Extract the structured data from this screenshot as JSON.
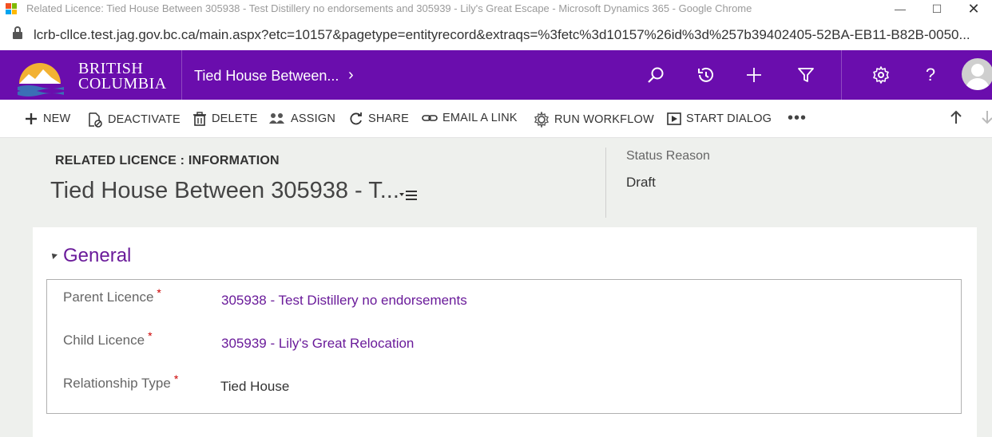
{
  "window": {
    "title": "Related Licence: Tied House Between 305938 - Test Distillery no endorsements and 305939 - Lily's Great Escape - Microsoft Dynamics 365 - Google Chrome"
  },
  "browser": {
    "url": "lcrb-cllce.test.jag.gov.bc.ca/main.aspx?etc=10157&pagetype=entityrecord&extraqs=%3fetc%3d10157%26id%3d%257b39402405-52BA-EB11-B82B-0050..."
  },
  "nav": {
    "logo_line1": "BRITISH",
    "logo_line2": "COLUMBIA",
    "breadcrumb": "Tied House Between...",
    "chevron": "›"
  },
  "commands": {
    "new": "NEW",
    "deactivate": "DEACTIVATE",
    "delete": "DELETE",
    "assign": "ASSIGN",
    "share": "SHARE",
    "email_link": "EMAIL A LINK",
    "run_workflow": "RUN WORKFLOW",
    "start_dialog": "START DIALOG",
    "more": "•••"
  },
  "header": {
    "entity_label": "RELATED LICENCE : INFORMATION",
    "record_title": "Tied House Between 305938 - T...",
    "status_label": "Status Reason",
    "status_value": "Draft"
  },
  "section": {
    "title": "General"
  },
  "fields": {
    "parent_label": "Parent Licence",
    "parent_value": "305938 - Test Distillery no endorsements",
    "child_label": "Child Licence",
    "child_value": "305939 - Lily's Great Relocation",
    "type_label": "Relationship Type",
    "type_value": "Tied House",
    "required_mark": "*"
  },
  "colors": {
    "nav_purple": "#6a0dad",
    "link_purple": "#6a1b9a",
    "required_red": "#cc0000"
  }
}
